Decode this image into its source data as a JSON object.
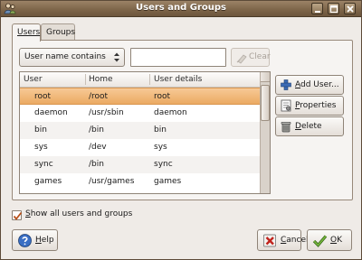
{
  "window": {
    "title": "Users and Groups"
  },
  "tabs": [
    {
      "label": "Users",
      "active": true
    },
    {
      "label": "Groups",
      "active": false
    }
  ],
  "filter": {
    "mode_selected": "User name contains",
    "search_value": "",
    "clear_label": "Clear"
  },
  "table": {
    "columns": [
      "User",
      "Home",
      "User details"
    ],
    "rows": [
      {
        "user": "root",
        "home": "/root",
        "details": "root",
        "selected": true
      },
      {
        "user": "daemon",
        "home": "/usr/sbin",
        "details": "daemon"
      },
      {
        "user": "bin",
        "home": "/bin",
        "details": "bin"
      },
      {
        "user": "sys",
        "home": "/dev",
        "details": "sys"
      },
      {
        "user": "sync",
        "home": "/bin",
        "details": "sync"
      },
      {
        "user": "games",
        "home": "/usr/games",
        "details": "games"
      }
    ]
  },
  "actions": {
    "add_user_prefix": "",
    "add_user_mnemonic": "A",
    "add_user_rest": "dd User...",
    "properties_mnemonic": "P",
    "properties_rest": "roperties",
    "delete_mnemonic": "D",
    "delete_rest": "elete"
  },
  "show_all": {
    "label_mnemonic": "S",
    "label_rest": "how all users and groups",
    "checked": true
  },
  "footer": {
    "help_mnemonic": "H",
    "help_rest": "elp",
    "cancel_mnemonic": "C",
    "cancel_rest": "ancel",
    "ok_mnemonic": "O",
    "ok_rest": "K"
  },
  "colors": {
    "selection": "#ebaa63",
    "titlebar": "#7c6448"
  },
  "icons": [
    "app-icon",
    "window-menu-icon",
    "minimize-icon",
    "maximize-icon",
    "close-icon",
    "combo-arrows-icon",
    "clear-icon",
    "add-user-icon",
    "properties-icon",
    "delete-icon",
    "help-icon",
    "cancel-icon",
    "ok-icon"
  ]
}
